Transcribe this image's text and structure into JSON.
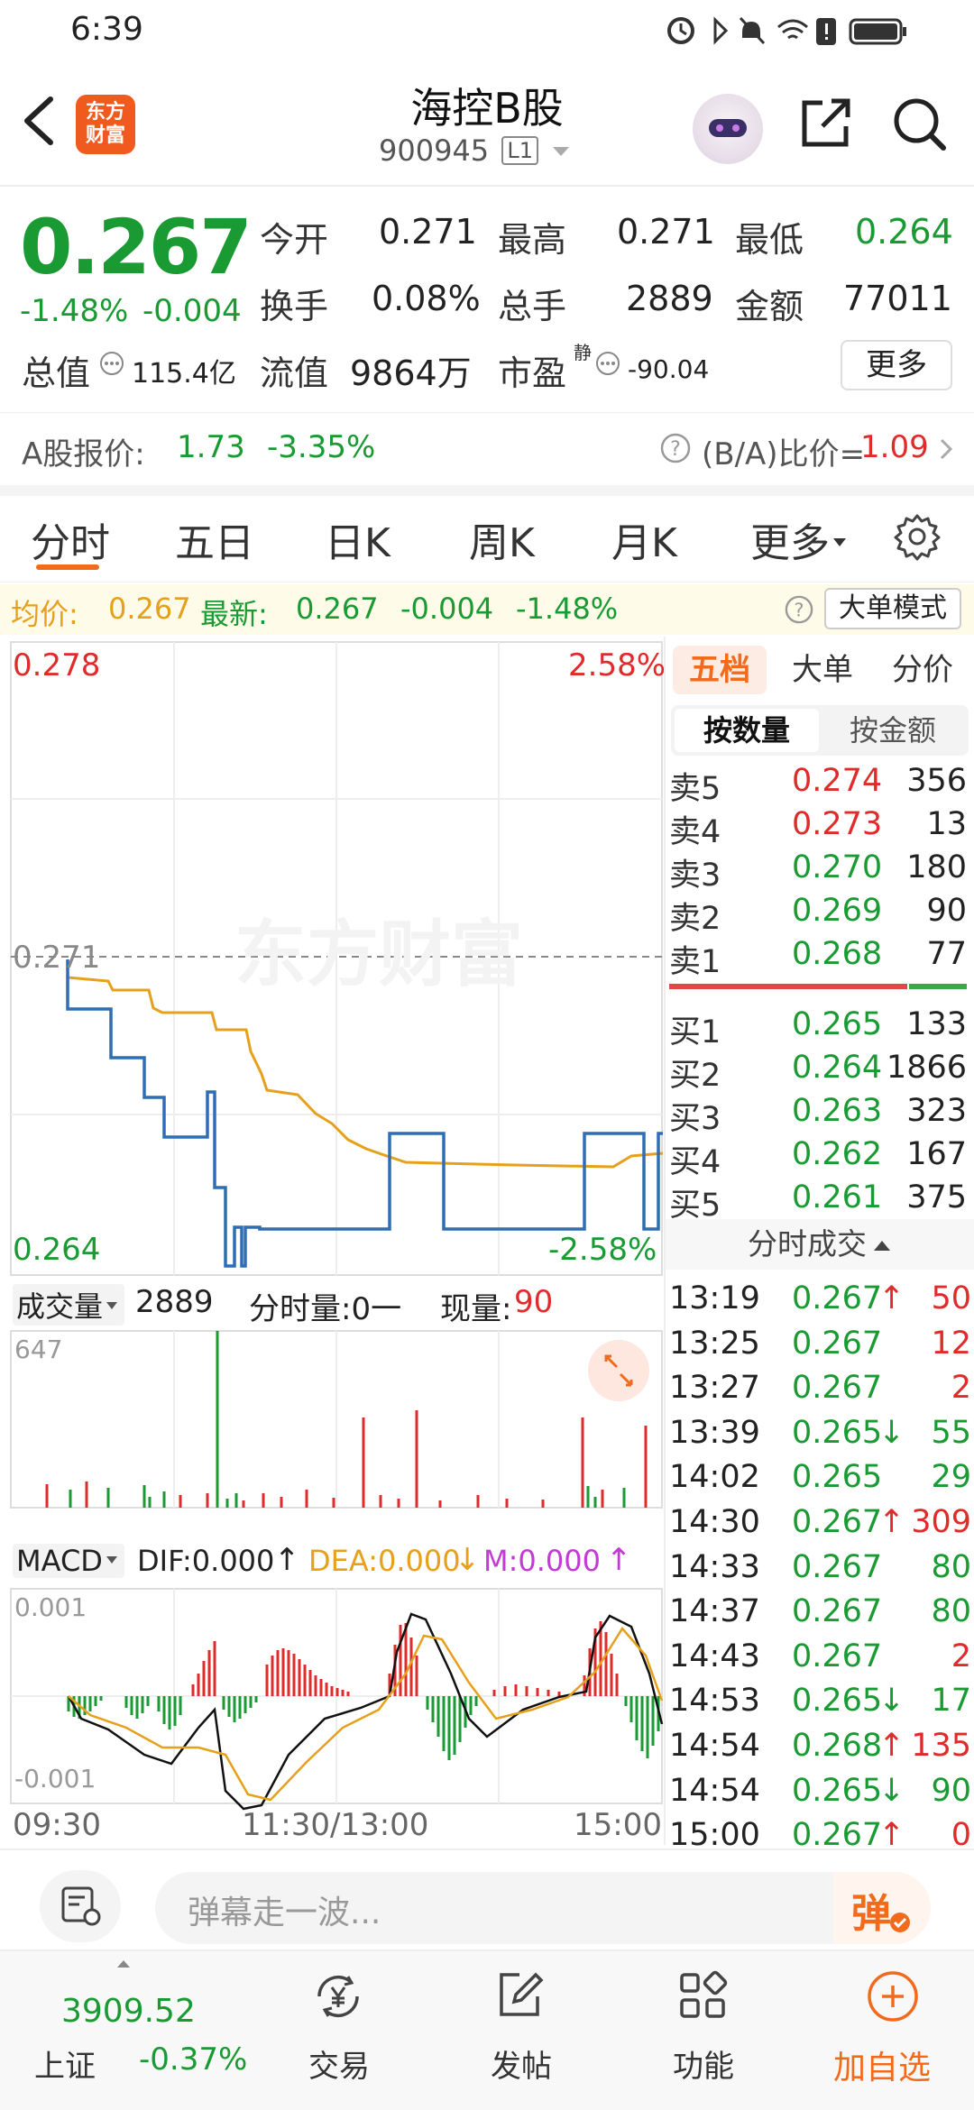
{
  "status_bar": {
    "time": "6:39"
  },
  "header": {
    "title": "海控B股",
    "code": "900945",
    "level": "L1",
    "logo_line1": "东方",
    "logo_line2": "财富"
  },
  "quote": {
    "price": "0.267",
    "change_pct": "-1.48%",
    "change": "-0.004",
    "items": [
      {
        "label": "今开",
        "value": "0.271"
      },
      {
        "label": "最高",
        "value": "0.271"
      },
      {
        "label": "最低",
        "value": "0.264"
      },
      {
        "label": "换手",
        "value": "0.08%"
      },
      {
        "label": "总手",
        "value": "2889"
      },
      {
        "label": "金额",
        "value": "77011"
      },
      {
        "label": "总值",
        "value": "115.4亿"
      },
      {
        "label": "流值",
        "value": "9864万"
      },
      {
        "label": "市盈",
        "value": "-90.04",
        "sup": "静"
      }
    ],
    "more_label": "更多"
  },
  "a_share": {
    "label": "A股报价:",
    "price": "1.73",
    "change": "-3.35%",
    "ratio_label": "(B/A)比价=",
    "ratio_value": "1.09"
  },
  "chart_tabs": [
    "分时",
    "五日",
    "日K",
    "周K",
    "月K",
    "更多"
  ],
  "info_line": {
    "avg_label": "均价:",
    "avg": "0.267",
    "latest_label": "最新:",
    "latest": "0.267",
    "change": "-0.004",
    "change_pct": "-1.48%",
    "mode_button": "大单模式"
  },
  "chart_labels": {
    "y_top": "0.278",
    "y_bottom": "0.264",
    "y_ref": "0.271",
    "pct_top": "2.58%",
    "pct_bottom": "-2.58%",
    "watermark": "东方财富"
  },
  "volume_bar": {
    "label": "成交量",
    "total": "2889",
    "minute_label": "分时量:0一",
    "now_label": "现量:",
    "now_value": "90",
    "max": "647"
  },
  "macd": {
    "label": "MACD",
    "dif": "DIF:0.000",
    "dea": "DEA:0.000",
    "m": "M:0.000",
    "top": "0.001",
    "bottom": "-0.001"
  },
  "time_axis": [
    "09:30",
    "11:30/13:00",
    "15:00"
  ],
  "panel_tabs": [
    "五档",
    "大单",
    "分价"
  ],
  "panel_subtabs": [
    "按数量",
    "按金额"
  ],
  "order_book": {
    "asks": [
      {
        "label": "卖5",
        "price": "0.274",
        "vol": "356",
        "color": "#e02b2b"
      },
      {
        "label": "卖4",
        "price": "0.273",
        "vol": "13",
        "color": "#e02b2b"
      },
      {
        "label": "卖3",
        "price": "0.270",
        "vol": "180",
        "color": "#1a9a32"
      },
      {
        "label": "卖2",
        "price": "0.269",
        "vol": "90",
        "color": "#1a9a32"
      },
      {
        "label": "卖1",
        "price": "0.268",
        "vol": "77",
        "color": "#1a9a32"
      }
    ],
    "bids": [
      {
        "label": "买1",
        "price": "0.265",
        "vol": "133",
        "color": "#1a9a32"
      },
      {
        "label": "买2",
        "price": "0.264",
        "vol": "1866",
        "color": "#1a9a32"
      },
      {
        "label": "买3",
        "price": "0.263",
        "vol": "323",
        "color": "#1a9a32"
      },
      {
        "label": "买4",
        "price": "0.262",
        "vol": "167",
        "color": "#1a9a32"
      },
      {
        "label": "买5",
        "price": "0.261",
        "vol": "375",
        "color": "#1a9a32"
      }
    ]
  },
  "trades_title": "分时成交",
  "trades": [
    {
      "time": "13:19",
      "price": "0.267",
      "arrow": "↑",
      "vol": "50",
      "vcolor": "#e02b2b"
    },
    {
      "time": "13:25",
      "price": "0.267",
      "arrow": "",
      "vol": "12",
      "vcolor": "#e02b2b"
    },
    {
      "time": "13:27",
      "price": "0.267",
      "arrow": "",
      "vol": "2",
      "vcolor": "#e02b2b"
    },
    {
      "time": "13:39",
      "price": "0.265",
      "arrow": "↓",
      "vol": "55",
      "vcolor": "#1a9a32"
    },
    {
      "time": "14:02",
      "price": "0.265",
      "arrow": "",
      "vol": "29",
      "vcolor": "#1a9a32"
    },
    {
      "time": "14:30",
      "price": "0.267",
      "arrow": "↑",
      "vol": "309",
      "vcolor": "#e02b2b"
    },
    {
      "time": "14:33",
      "price": "0.267",
      "arrow": "",
      "vol": "80",
      "vcolor": "#1a9a32"
    },
    {
      "time": "14:37",
      "price": "0.267",
      "arrow": "",
      "vol": "80",
      "vcolor": "#1a9a32"
    },
    {
      "time": "14:43",
      "price": "0.267",
      "arrow": "",
      "vol": "2",
      "vcolor": "#e02b2b"
    },
    {
      "time": "14:53",
      "price": "0.265",
      "arrow": "↓",
      "vol": "17",
      "vcolor": "#1a9a32"
    },
    {
      "time": "14:54",
      "price": "0.268",
      "arrow": "↑",
      "vol": "135",
      "vcolor": "#e02b2b"
    },
    {
      "time": "14:54",
      "price": "0.265",
      "arrow": "↓",
      "vol": "90",
      "vcolor": "#1a9a32"
    },
    {
      "time": "15:00",
      "price": "0.267",
      "arrow": "↑",
      "vol": "0",
      "vcolor": "#e02b2b"
    }
  ],
  "comment_bar": {
    "placeholder": "弹幕走一波...",
    "danmu": "弹"
  },
  "bottom_nav": {
    "index_value": "3909.52",
    "index_name": "上证",
    "index_change": "-0.37%",
    "items": [
      "交易",
      "发帖",
      "功能",
      "加自选"
    ]
  }
}
